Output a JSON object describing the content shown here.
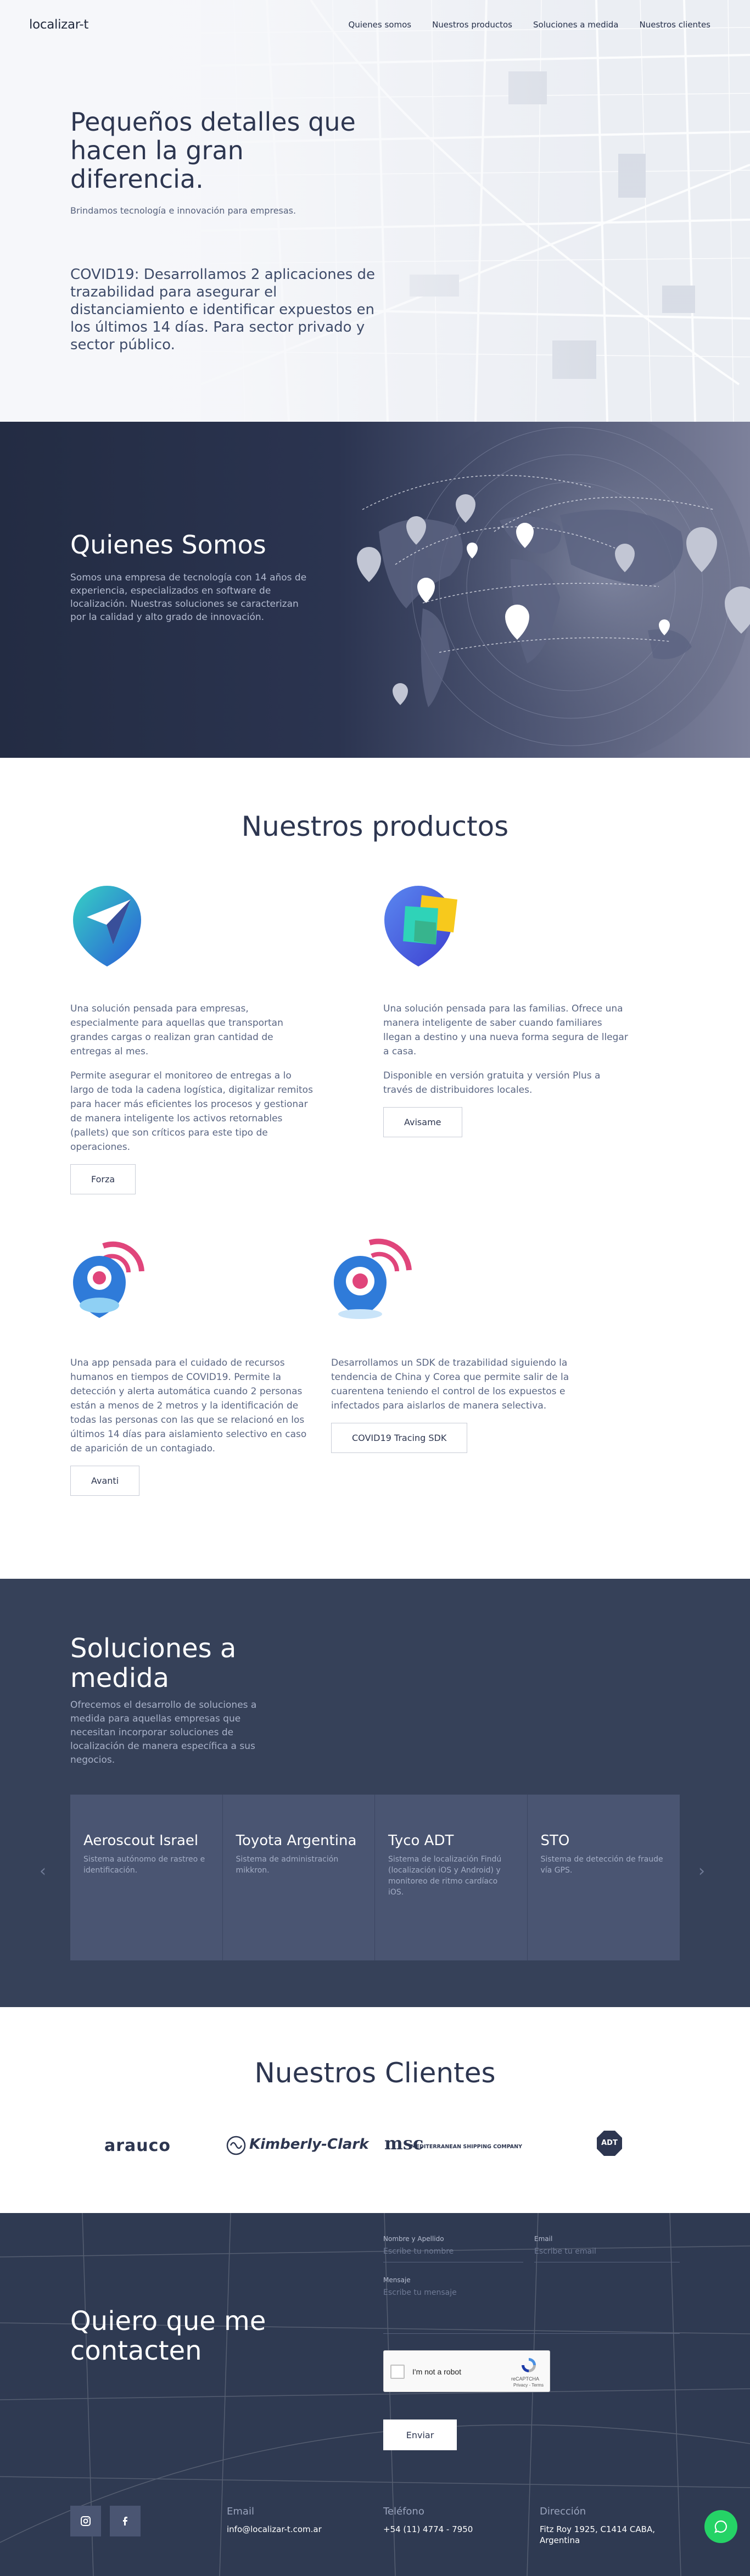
{
  "nav": {
    "logo": "localizar-t",
    "links": [
      "Quienes somos",
      "Nuestros productos",
      "Soluciones a medida",
      "Nuestros clientes"
    ]
  },
  "hero": {
    "title": "Pequeños detalles que hacen la gran diferencia.",
    "subtitle": "Brindamos tecnología e innovación para empresas.",
    "covid_text": "COVID19: Desarrollamos 2 aplicaciones de trazabilidad para asegurar el distanciamiento e identificar expuestos en los últimos 14 días. Para sector privado y sector público."
  },
  "about": {
    "title": "Quienes Somos",
    "text": "Somos una empresa de tecnología con 14 años de experiencia, especializados en software de localización. Nuestras soluciones se caracterizan por la calidad y alto grado de innovación."
  },
  "products": {
    "title": "Nuestros productos",
    "items": [
      {
        "p1": "Una solución pensada para empresas, especialmente para aquellas que transportan grandes cargas o realizan gran cantidad de entregas al mes.",
        "p2": "Permite asegurar el monitoreo de entregas a lo largo de toda la cadena logística, digitalizar remitos para hacer más eficientes los procesos y gestionar de manera inteligente los activos retornables (pallets) que son críticos para este tipo de operaciones.",
        "button": "Forza"
      },
      {
        "p1": "Una solución pensada para las familias. Ofrece una manera inteligente de saber cuando familiares llegan a destino y una nueva forma segura de llegar a casa.",
        "p2": "Disponible en versión gratuita y versión Plus a través de distribuidores locales.",
        "button": "Avisame"
      },
      {
        "p1": "Una app pensada para el cuidado de recursos humanos en tiempos de COVID19. Permite la detección y alerta automática cuando 2 personas están a menos de 2 metros y la identificación de todas las personas con las que se relacionó en los últimos 14 días para aislamiento selectivo en caso de aparición de un contagiado.",
        "button": "Avanti"
      },
      {
        "p1": "Desarrollamos un SDK de trazabilidad siguiendo la tendencia de China y Corea que permite salir de la cuarentena teniendo el control de los expuestos e infectados para aislarlos de manera selectiva.",
        "button": "COVID19 Tracing SDK"
      }
    ]
  },
  "solutions": {
    "title": "Soluciones a medida",
    "description": "Ofrecemos el desarrollo de soluciones a medida para aquellas empresas que necesitan incorporar soluciones de localización de manera específica a sus negocios.",
    "cards": [
      {
        "title": "Aeroscout Israel",
        "text": "Sistema autónomo de rastreo e identificación."
      },
      {
        "title": "Toyota Argentina",
        "text": "Sistema de administración mikkron."
      },
      {
        "title": "Tyco ADT",
        "text": "Sistema de localización Findú (localización iOS y Android) y monitoreo de ritmo cardíaco iOS."
      },
      {
        "title": "STO",
        "text": "Sistema de detección de fraude vía GPS."
      }
    ],
    "prev_icon": "chevron-left-icon",
    "next_icon": "chevron-right-icon"
  },
  "clients": {
    "title": "Nuestros Clientes",
    "logos": [
      {
        "name": "arauco",
        "text": "arauco"
      },
      {
        "name": "kimberly-clark",
        "text": "Kimberly-Clark"
      },
      {
        "name": "msc",
        "text": "msc",
        "caption": "MEDITERRANEAN SHIPPING COMPANY"
      },
      {
        "name": "adt",
        "text": "ADT"
      }
    ]
  },
  "contact": {
    "title": "Quiero que me contacten",
    "form": {
      "name_label": "Nombre y Apellido",
      "name_placeholder": "Escribe tu nombre",
      "email_label": "Email",
      "email_placeholder": "Escribe tu email",
      "message_label": "Mensaje",
      "message_placeholder": "Escribe tu mensaje",
      "captcha_label": "I'm not a robot",
      "captcha_brand": "reCAPTCHA",
      "captcha_links": "Privacy - Terms",
      "submit": "Enviar"
    },
    "footer": {
      "email_heading": "Email",
      "email_value": "info@localizar-t.com.ar",
      "phone_heading": "Teléfono",
      "phone_value": "+54 (11) 4774 - 7950",
      "address_heading": "Dirección",
      "address_value": "Fitz Roy 1925, C1414 CABA, Argentina"
    },
    "social": [
      "instagram-icon",
      "facebook-icon"
    ],
    "chat_icon": "chat-icon"
  },
  "colors": {
    "dark_navy": "#232c43",
    "slate": "#364159",
    "card": "#4a5572",
    "accent_blue": "#2f7bd9",
    "accent_pink": "#e0457b",
    "whatsapp_green": "#25d366"
  }
}
